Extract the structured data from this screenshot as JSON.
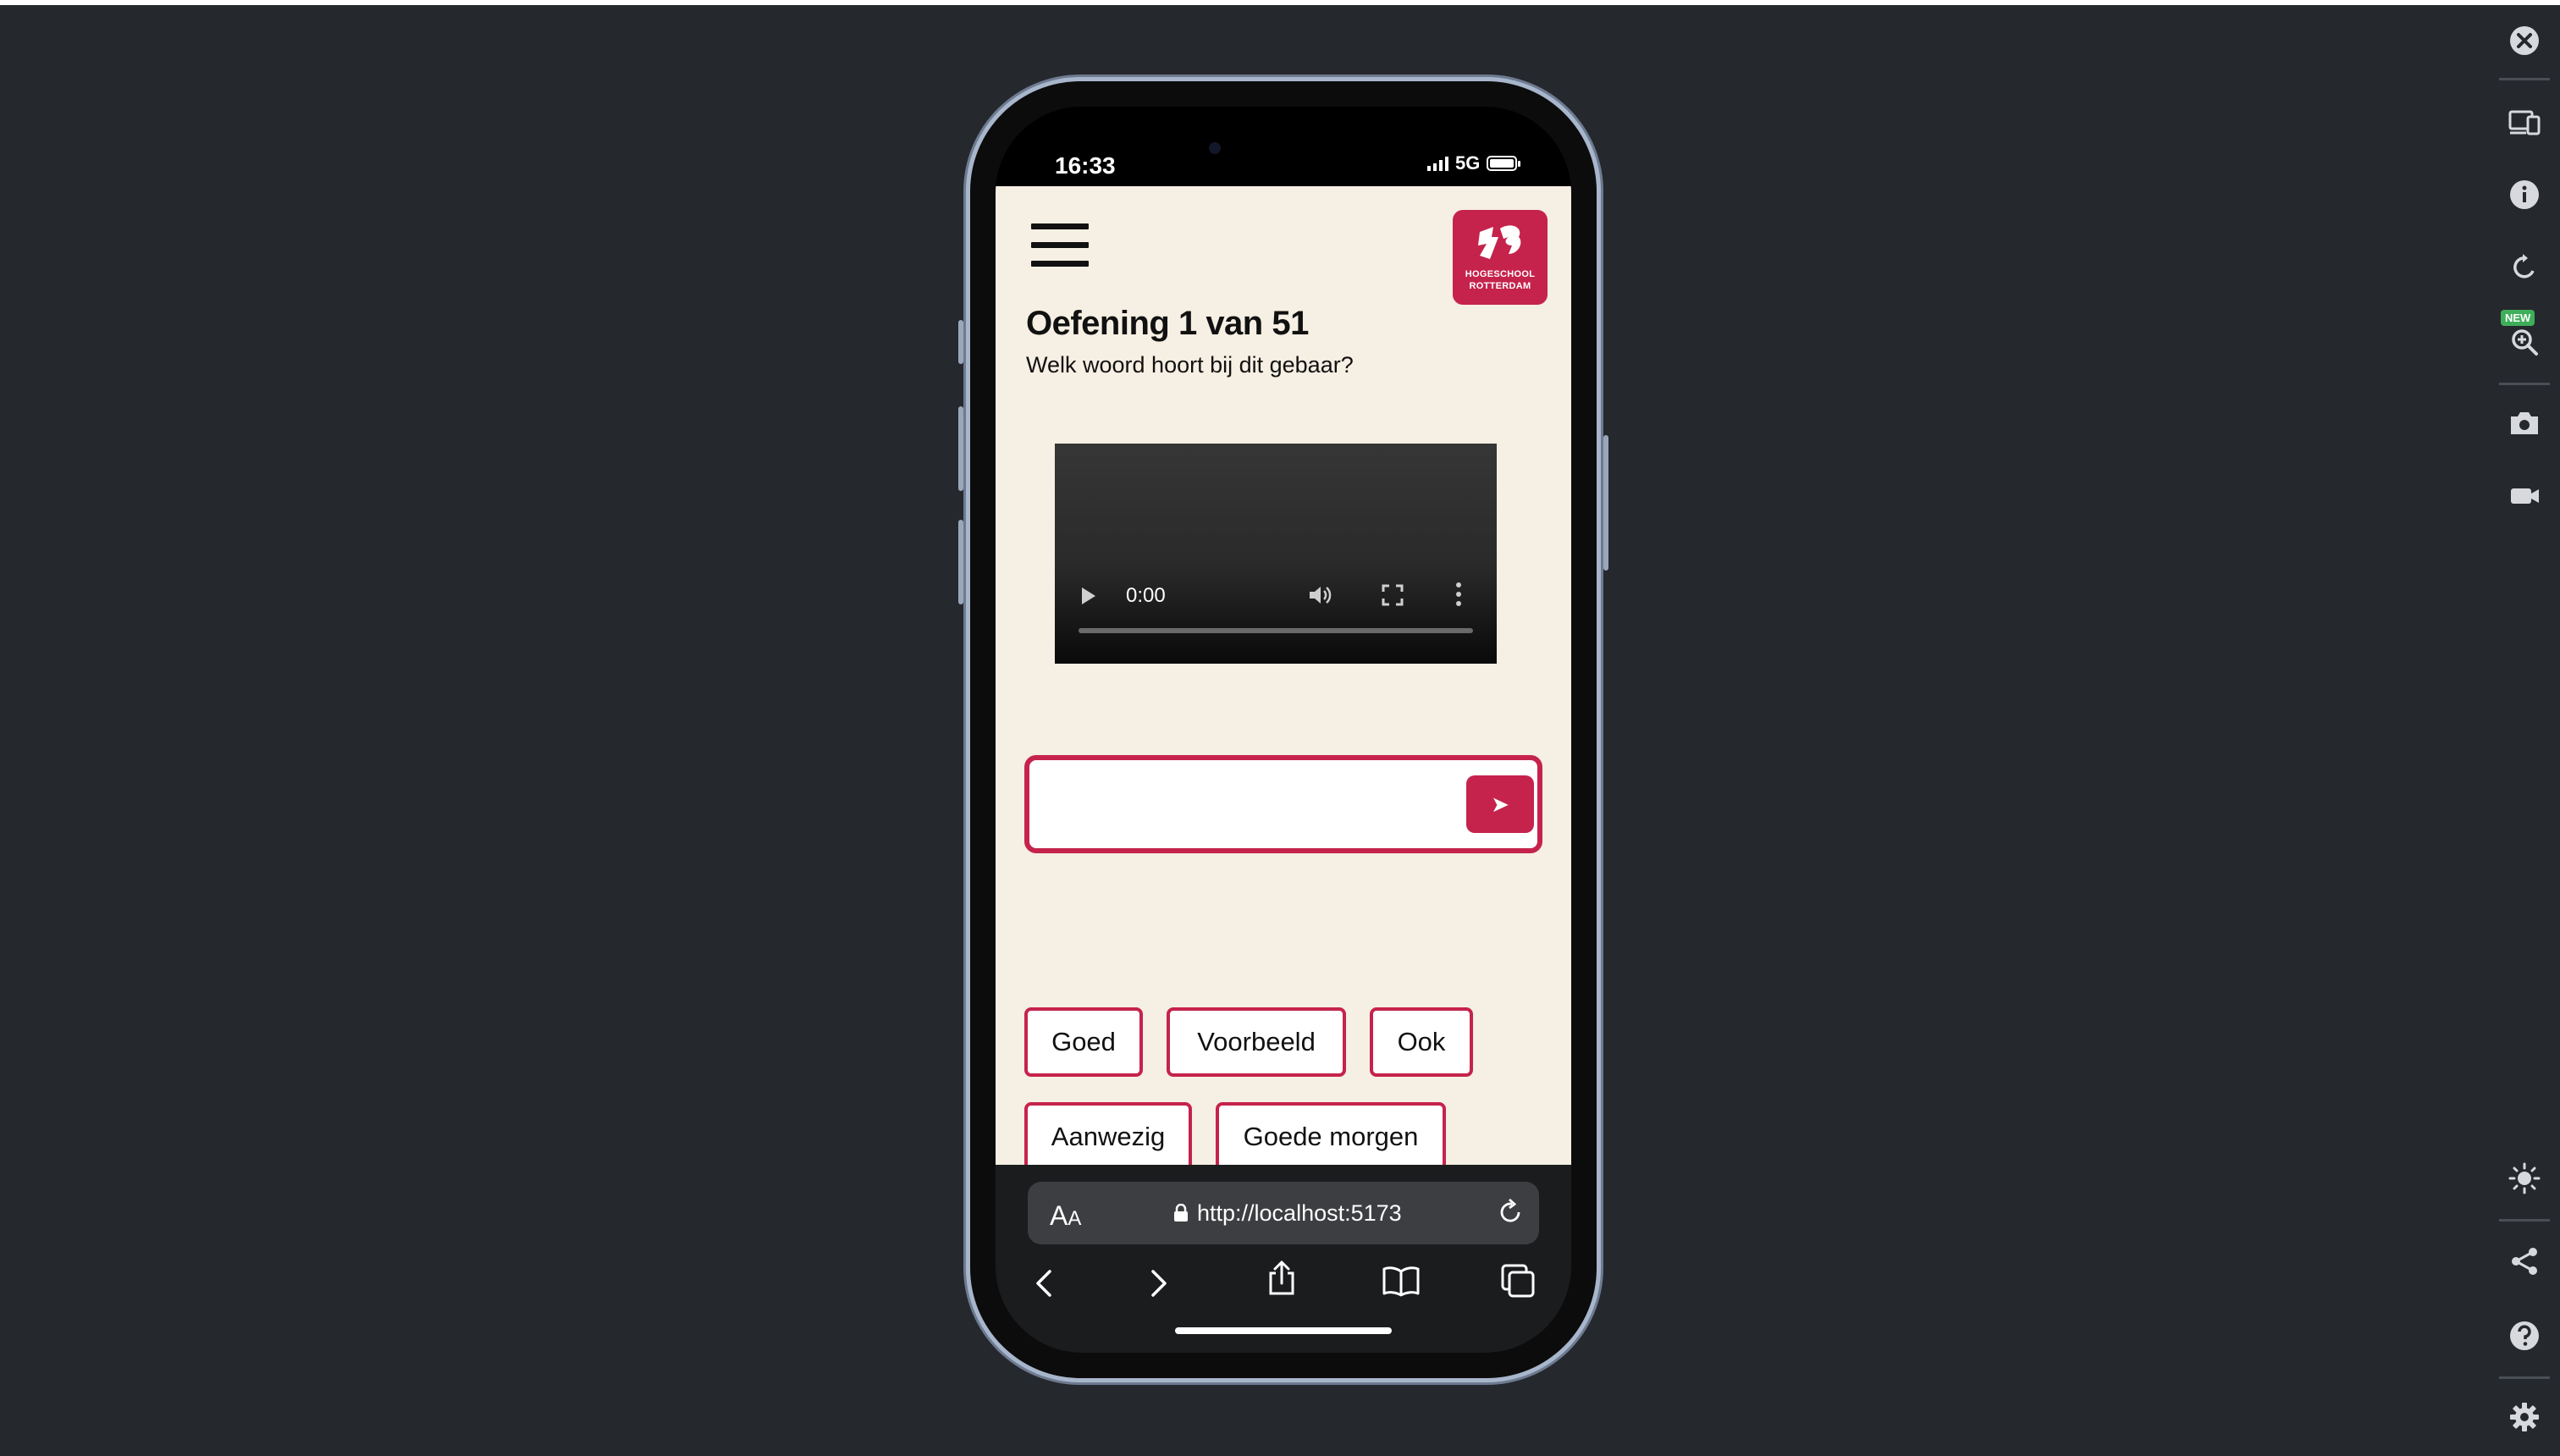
{
  "status_bar": {
    "time": "16:33",
    "network": "5G"
  },
  "logo": {
    "line1": "HOGESCHOOL",
    "line2": "ROTTERDAM"
  },
  "exercise": {
    "title": "Oefening 1 van 51",
    "question": "Welk woord hoort bij dit gebaar?"
  },
  "video": {
    "time": "0:00",
    "progress": 0
  },
  "answer": {
    "value": "",
    "placeholder": "",
    "send_icon": "➤"
  },
  "options": [
    "Goed",
    "Voorbeeld",
    "Ook",
    "Aanwezig",
    "Goede morgen"
  ],
  "browser": {
    "text_size": "A",
    "text_size_small": "A",
    "url": "http://localhost:5173"
  },
  "colors": {
    "accent": "#c5234c",
    "background": "#f6efe3",
    "desktop": "#25282d"
  },
  "toolbar_icons": [
    "close-icon",
    "device-icon",
    "info-icon",
    "rotate-icon",
    "zoom-icon",
    "camera-icon",
    "video-record-icon",
    "brightness-icon",
    "share-icon",
    "help-icon",
    "settings-icon"
  ],
  "toolbar_badge": "NEW"
}
